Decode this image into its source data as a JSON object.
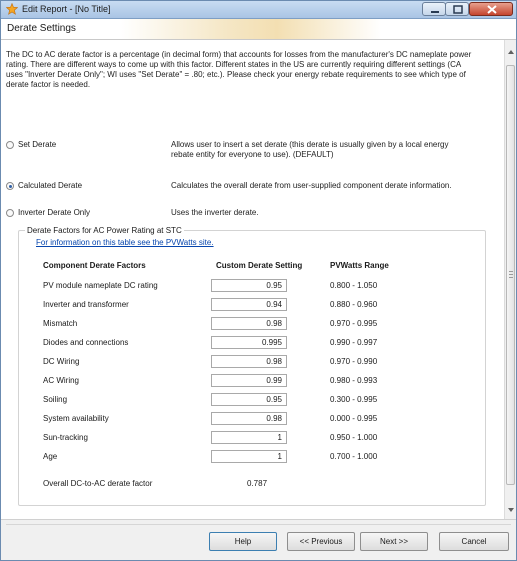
{
  "window": {
    "title": "Edit Report - [No Title]",
    "icon": "star-app-icon"
  },
  "header": {
    "section_title": "Derate Settings"
  },
  "intro_text": "The DC to AC derate factor is a percentage (in decimal form) that accounts for losses from the manufacturer's DC nameplate power rating. There are different ways to come up with this factor. Different states in the US are currently requiring different settings (CA uses \"Inverter Derate Only\"; WI uses \"Set Derate\" = .80; etc.).  Please check your energy rebate requirements to see which type of derate factor is needed.",
  "derate_options": [
    {
      "label": "Set Derate",
      "description": "Allows user to insert a set derate (this derate is usually given by a local energy rebate entity for everyone to use).  (DEFAULT)",
      "selected": false
    },
    {
      "label": "Calculated Derate",
      "description": "Calculates the overall derate from user-supplied component derate information.",
      "selected": true
    },
    {
      "label": "Inverter Derate Only",
      "description": "Uses the inverter derate.",
      "selected": false
    }
  ],
  "factors_group": {
    "legend": "Derate Factors for AC Power Rating at STC",
    "link_text": "For information on this table see the PVWatts site.",
    "columns": [
      "Component Derate Factors",
      "Custom Derate Setting",
      "PVWatts Range"
    ],
    "rows": [
      {
        "component": "PV module nameplate DC rating",
        "setting": "0.95",
        "range": "0.800 - 1.050"
      },
      {
        "component": "Inverter and transformer",
        "setting": "0.94",
        "range": "0.880 - 0.960"
      },
      {
        "component": "Mismatch",
        "setting": "0.98",
        "range": "0.970 - 0.995"
      },
      {
        "component": "Diodes and connections",
        "setting": "0.995",
        "range": "0.990 - 0.997"
      },
      {
        "component": "DC Wiring",
        "setting": "0.98",
        "range": "0.970 - 0.990"
      },
      {
        "component": "AC Wiring",
        "setting": "0.99",
        "range": "0.980 - 0.993"
      },
      {
        "component": "Soiling",
        "setting": "0.95",
        "range": "0.300 - 0.995"
      },
      {
        "component": "System availability",
        "setting": "0.98",
        "range": "0.000 - 0.995"
      },
      {
        "component": "Sun-tracking",
        "setting": "1",
        "range": "0.950 - 1.000"
      },
      {
        "component": "Age",
        "setting": "1",
        "range": "0.700 - 1.000"
      }
    ],
    "overall_label": "Overall DC-to-AC derate factor",
    "overall_value": "0.787"
  },
  "buttons": {
    "help": "Help",
    "previous": "<< Previous",
    "next": "Next >>",
    "cancel": "Cancel"
  },
  "colors": {
    "titlebar": "#a9c4e4",
    "link": "#0645ad",
    "close_button": "#c5452f",
    "radio_selected": "#2f5fa5"
  }
}
